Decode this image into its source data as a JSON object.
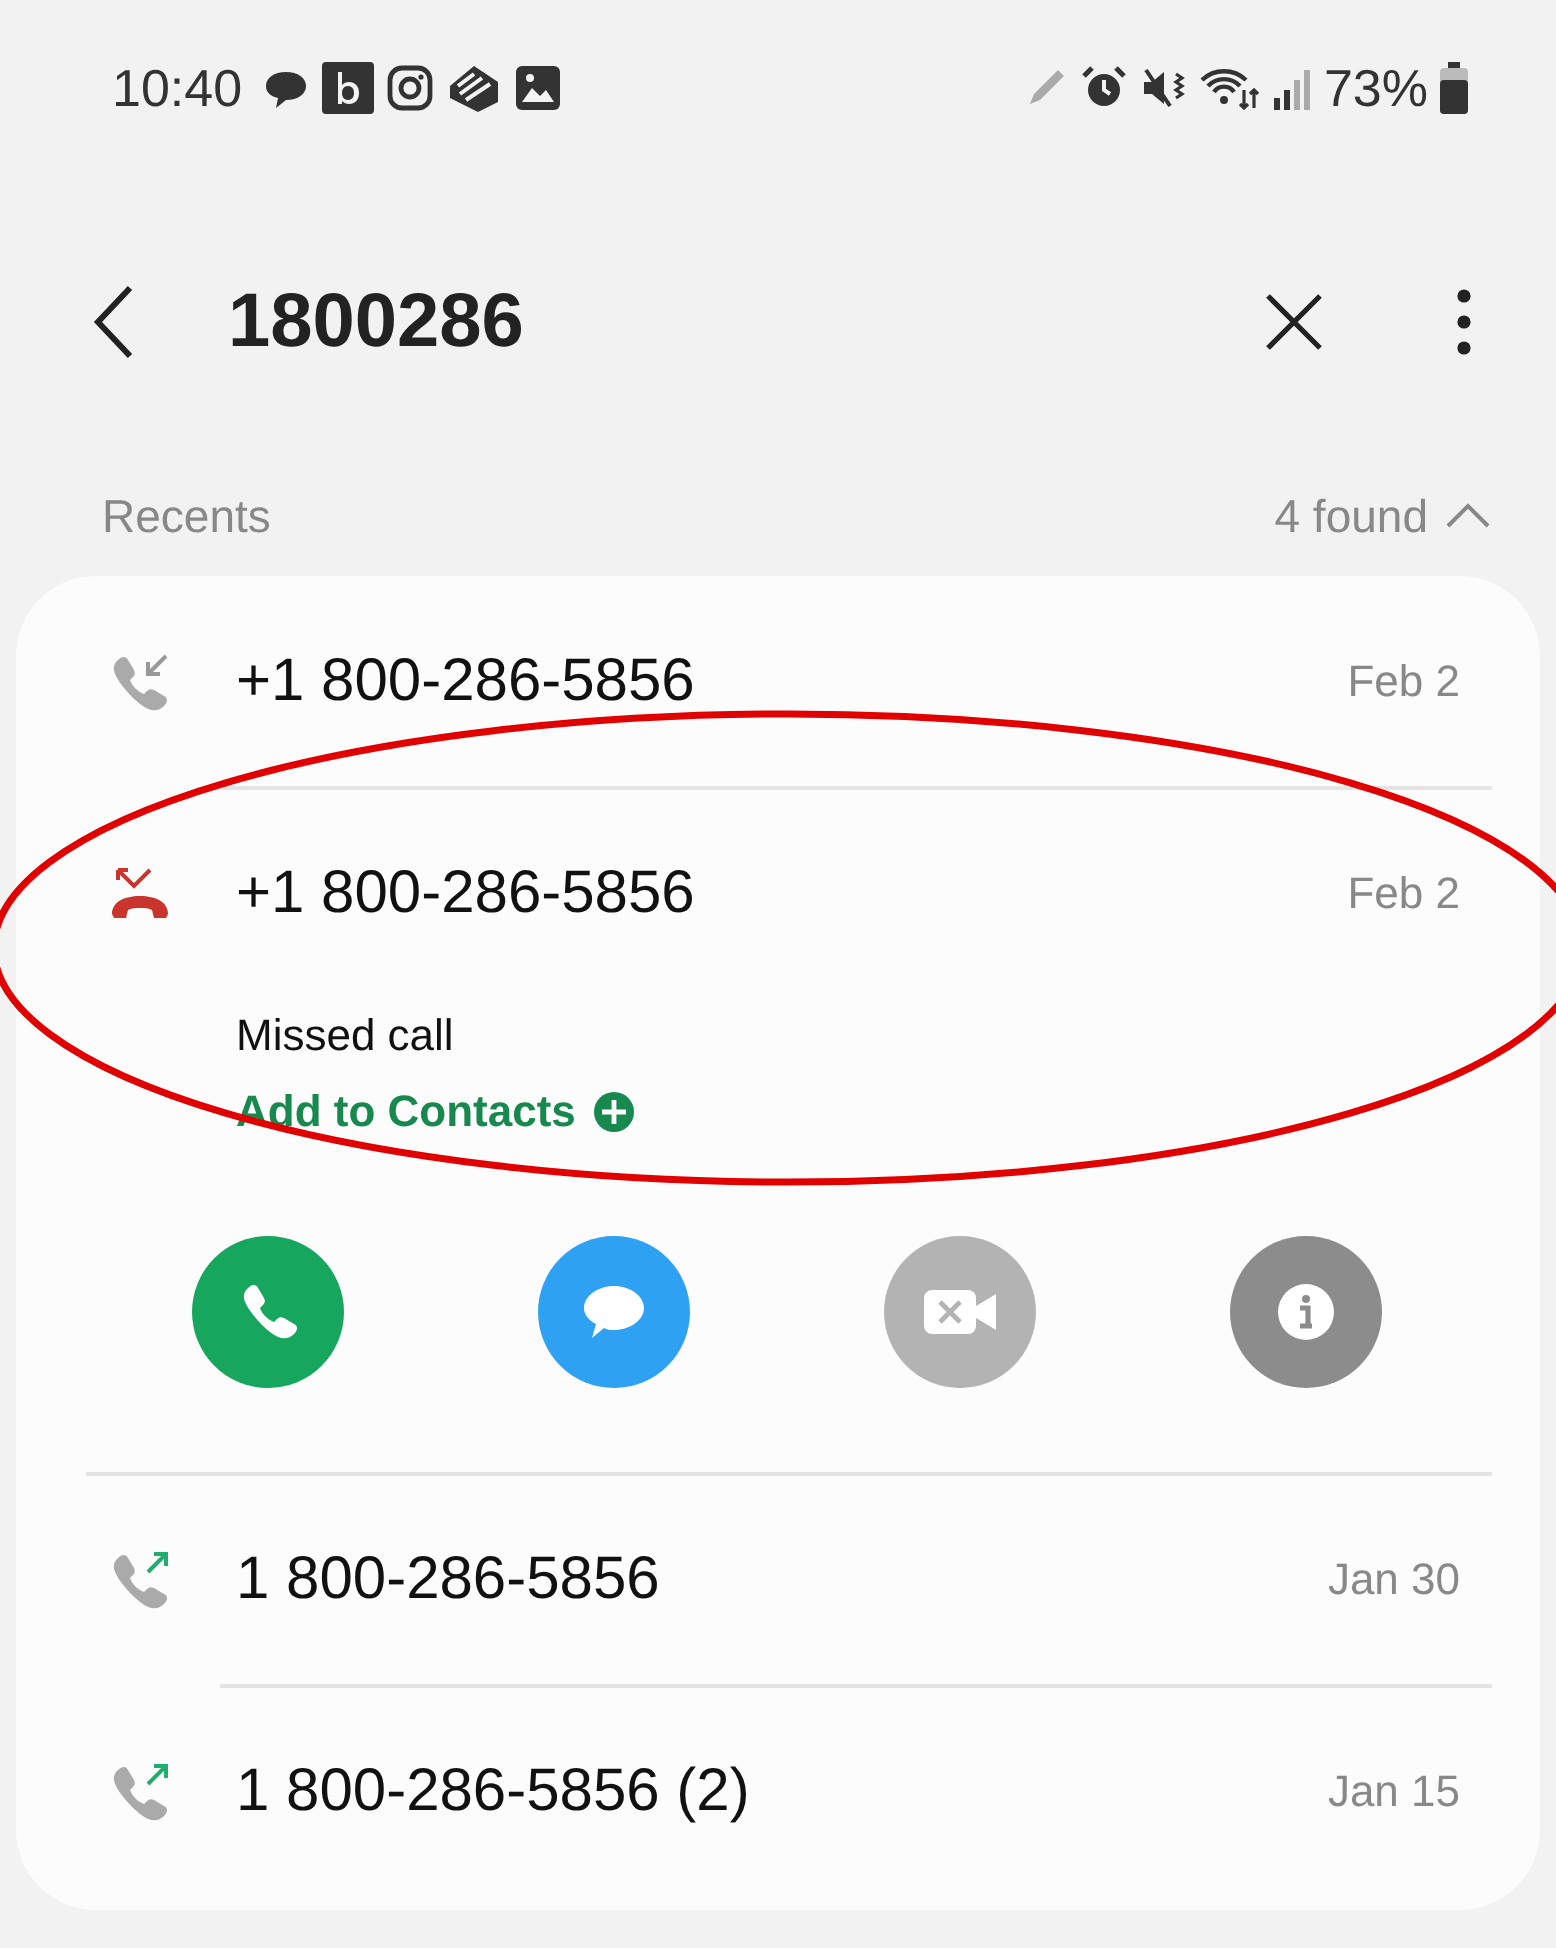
{
  "status_bar": {
    "time": "10:40",
    "battery": "73%"
  },
  "header": {
    "query": "1800286"
  },
  "section": {
    "title": "Recents",
    "count": "4 found",
    "expanded": true
  },
  "calls": [
    {
      "kind": "incoming",
      "number": "+1 800-286-5856",
      "date": "Feb 2",
      "expanded": false,
      "circled": false
    },
    {
      "kind": "missed",
      "number": "+1 800-286-5856",
      "date": "Feb 2",
      "expanded": true,
      "circled": true,
      "detail": "Missed call",
      "link": "Add to Contacts",
      "actions": [
        {
          "kind": "call",
          "disabled": false
        },
        {
          "kind": "message",
          "disabled": false
        },
        {
          "kind": "video",
          "disabled": true
        },
        {
          "kind": "info",
          "disabled": false
        }
      ]
    },
    {
      "kind": "outgoing",
      "number": "1 800-286-5856",
      "date": "Jan 30",
      "expanded": false,
      "circled": false
    },
    {
      "kind": "outgoing",
      "number": "1 800-286-5856 (2)",
      "date": "Jan 15",
      "expanded": false,
      "circled": false
    }
  ]
}
